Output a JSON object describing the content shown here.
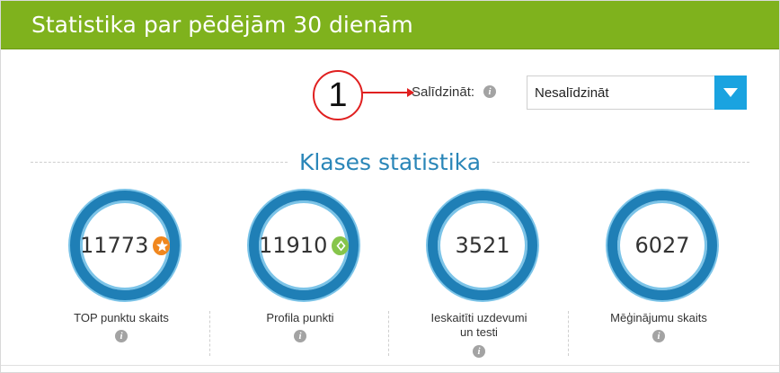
{
  "header": {
    "title": "Statistika par pēdējām 30 dienām"
  },
  "callout": {
    "number": "1"
  },
  "compare": {
    "label": "Salīdzināt:",
    "info_icon": "i",
    "selected": "Nesalīdzināt"
  },
  "section": {
    "title": "Klases statistika"
  },
  "stats": [
    {
      "value": "11773",
      "label": "TOP punktu skaits",
      "badge": "star-badge-icon"
    },
    {
      "value": "11910",
      "label": "Profila punkti",
      "badge": "diamond-badge-icon"
    },
    {
      "value": "3521",
      "label": "Ieskaitīti uzdevumi un testi",
      "badge": ""
    },
    {
      "value": "6027",
      "label": "Mēģinājumu skaits",
      "badge": ""
    }
  ],
  "colors": {
    "header_bg": "#7fb21d",
    "ring": "#1f7fb6",
    "accent_blue": "#2a86b8",
    "select_button": "#1aa3e0",
    "callout": "#e02020"
  }
}
